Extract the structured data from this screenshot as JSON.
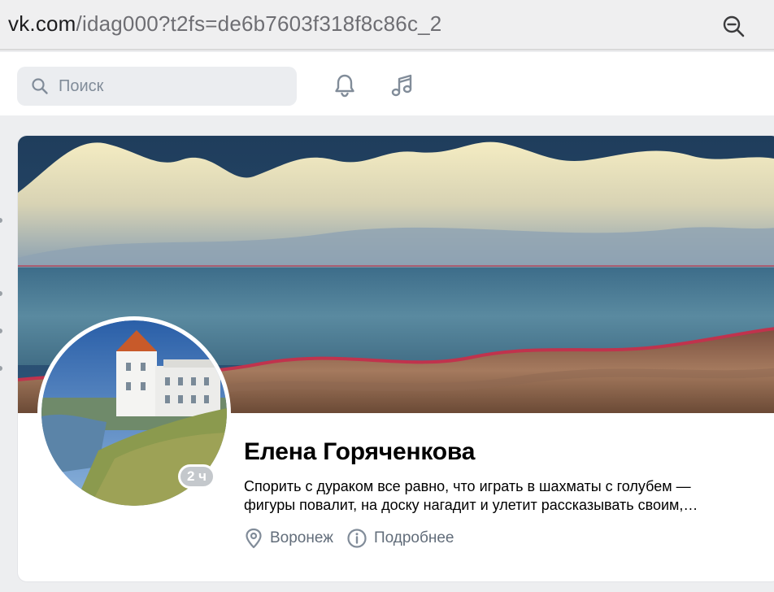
{
  "browser": {
    "url_host": "vk.com",
    "url_path": "/idag000?t2fs=de6b7603f318f8c86c_2",
    "zoom_icon": "zoom-out-icon"
  },
  "header": {
    "search_placeholder": "Поиск",
    "icons": [
      "search-icon",
      "bell-icon",
      "music-note-icon"
    ]
  },
  "profile": {
    "name": "Елена Горяченкова",
    "status_line1": "Спорить с дураком все равно, что играть в шахматы с голубем —",
    "status_line2": "фигуры повалит, на доску нагадит и улетит рассказывать своим,…",
    "location": "Воронеж",
    "details_label": "Подробнее",
    "last_seen": "2 ч"
  },
  "colors": {
    "page_bg": "#edeef0",
    "card_bg": "#ffffff",
    "muted_text": "#626d7a",
    "badge_bg": "#c4c8cc"
  }
}
